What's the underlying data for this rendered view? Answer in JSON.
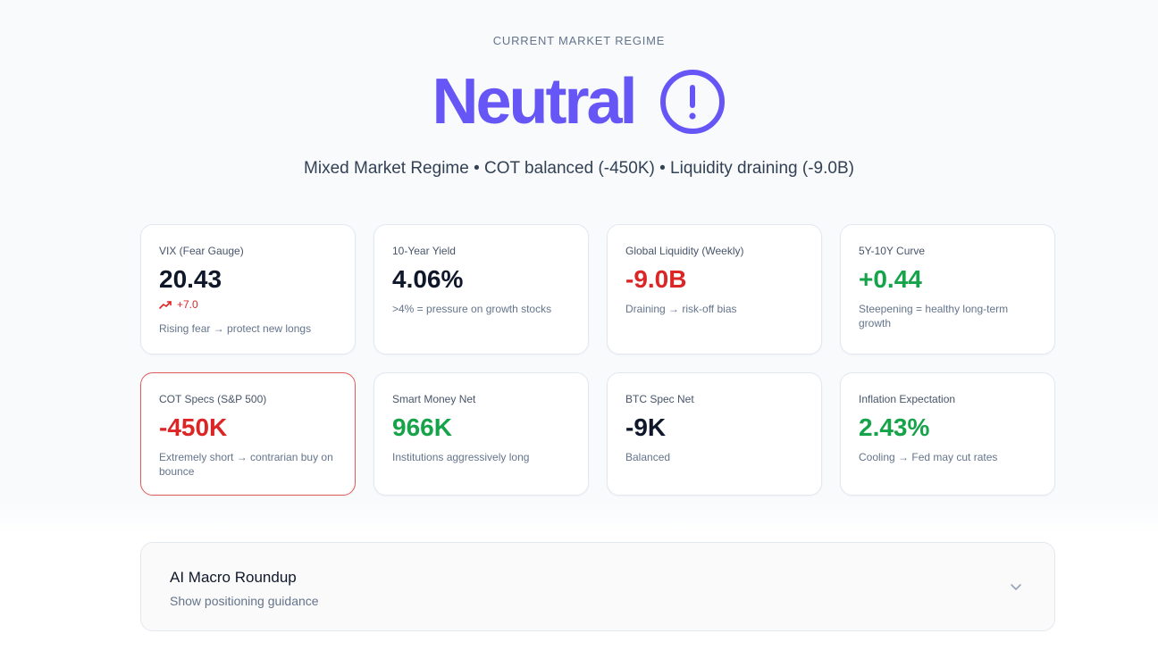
{
  "header": {
    "eyebrow": "CURRENT MARKET REGIME",
    "regime": "Neutral",
    "regime_icon": "alert-circle-icon",
    "summary": "Mixed Market Regime • COT balanced (-450K) • Liquidity draining (-9.0B)"
  },
  "colors": {
    "accent": "#6656f5",
    "negative": "#dc2626",
    "positive": "#16a34a",
    "alert_border": "#e05a5a"
  },
  "metrics": [
    {
      "label": "VIX (Fear Gauge)",
      "value": "20.43",
      "delta": "+7.0",
      "delta_icon": "trending-up-icon",
      "note": "Rising fear → protect new longs"
    },
    {
      "label": "10-Year Yield",
      "value": "4.06%",
      "note": ">4% = pressure on growth stocks"
    },
    {
      "label": "Global Liquidity (Weekly)",
      "value": "-9.0B",
      "note": "Draining → risk-off bias"
    },
    {
      "label": "5Y-10Y Curve",
      "value": "+0.44",
      "note": "Steepening = healthy long-term growth"
    },
    {
      "label": "COT Specs (S&P 500)",
      "value": "-450K",
      "note": "Extremely short → contrarian buy on bounce"
    },
    {
      "label": "Smart Money Net",
      "value": "966K",
      "note": "Institutions aggressively long"
    },
    {
      "label": "BTC Spec Net",
      "value": "-9K",
      "note": "Balanced"
    },
    {
      "label": "Inflation Expectation",
      "value": "2.43%",
      "note": "Cooling → Fed may cut rates"
    }
  ],
  "roundup": {
    "title": "AI Macro Roundup",
    "subtitle": "Show positioning guidance",
    "toggle_icon": "chevron-down-icon"
  }
}
